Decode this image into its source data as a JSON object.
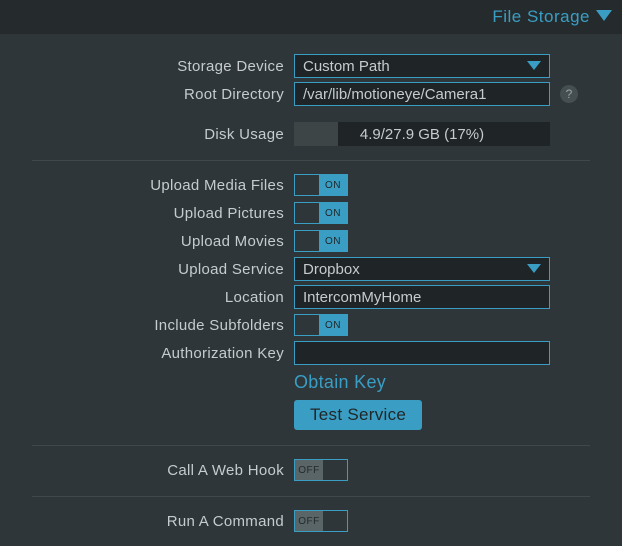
{
  "header": {
    "title": "File Storage"
  },
  "storage_device": {
    "label": "Storage Device",
    "value": "Custom Path"
  },
  "root_directory": {
    "label": "Root Directory",
    "value": "/var/lib/motioneye/Camera1"
  },
  "disk_usage": {
    "label": "Disk Usage",
    "text": "4.9/27.9 GB (17%)",
    "percent": 17
  },
  "upload_media": {
    "label": "Upload Media Files",
    "on_text": "ON"
  },
  "upload_pictures": {
    "label": "Upload Pictures",
    "on_text": "ON"
  },
  "upload_movies": {
    "label": "Upload Movies",
    "on_text": "ON"
  },
  "upload_service": {
    "label": "Upload Service",
    "value": "Dropbox"
  },
  "location": {
    "label": "Location",
    "value": "IntercomMyHome"
  },
  "include_subfolders": {
    "label": "Include Subfolders",
    "on_text": "ON"
  },
  "auth_key": {
    "label": "Authorization Key",
    "value": ""
  },
  "obtain_key": {
    "label": "Obtain Key"
  },
  "test_service": {
    "label": "Test Service"
  },
  "web_hook": {
    "label": "Call A Web Hook",
    "off_text": "OFF"
  },
  "run_command": {
    "label": "Run A Command",
    "off_text": "OFF"
  },
  "help": {
    "glyph": "?"
  }
}
